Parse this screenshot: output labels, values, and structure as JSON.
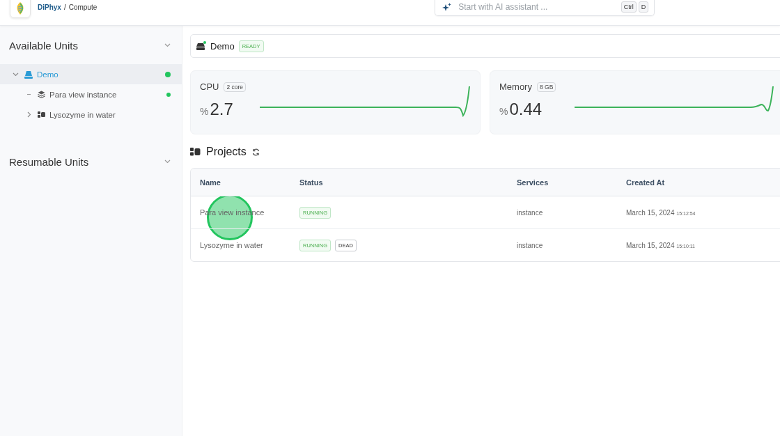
{
  "header": {
    "brand": "DiPhyx",
    "separator": "/",
    "page": "Compute",
    "search": {
      "placeholder": "Start with AI assistant ...",
      "keys": [
        "Ctrl",
        "D"
      ]
    }
  },
  "sidebar": {
    "sections": [
      {
        "title": "Available Units",
        "items": [
          {
            "label": "Demo",
            "selected": true,
            "expanded": true,
            "online": true,
            "children": [
              {
                "label": "Para view instance",
                "kind": "leaf",
                "online": true
              },
              {
                "label": "Lysozyme in water",
                "kind": "group",
                "expanded": false,
                "online": false
              }
            ]
          }
        ]
      },
      {
        "title": "Resumable Units"
      }
    ]
  },
  "unit": {
    "name": "Demo",
    "status": "READY",
    "online": true
  },
  "metrics": [
    {
      "label": "CPU",
      "badge": "2 core",
      "unit": "%",
      "value": "2.7"
    },
    {
      "label": "Memory",
      "badge": "8 GB",
      "unit": "%",
      "value": "0.44"
    }
  ],
  "projects": {
    "title": "Projects",
    "columns": [
      "Name",
      "Status",
      "Services",
      "Created At"
    ],
    "rows": [
      {
        "name": "Para view instance",
        "statuses": [
          {
            "label": "RUNNING",
            "kind": "running"
          }
        ],
        "services": "instance",
        "date": "March 15, 2024",
        "time": "15:12:54"
      },
      {
        "name": "Lysozyme in water",
        "statuses": [
          {
            "label": "RUNNING",
            "kind": "running"
          },
          {
            "label": "DEAD",
            "kind": "dead"
          }
        ],
        "services": "instance",
        "date": "March 15, 2024",
        "time": "15:10:11"
      }
    ]
  }
}
